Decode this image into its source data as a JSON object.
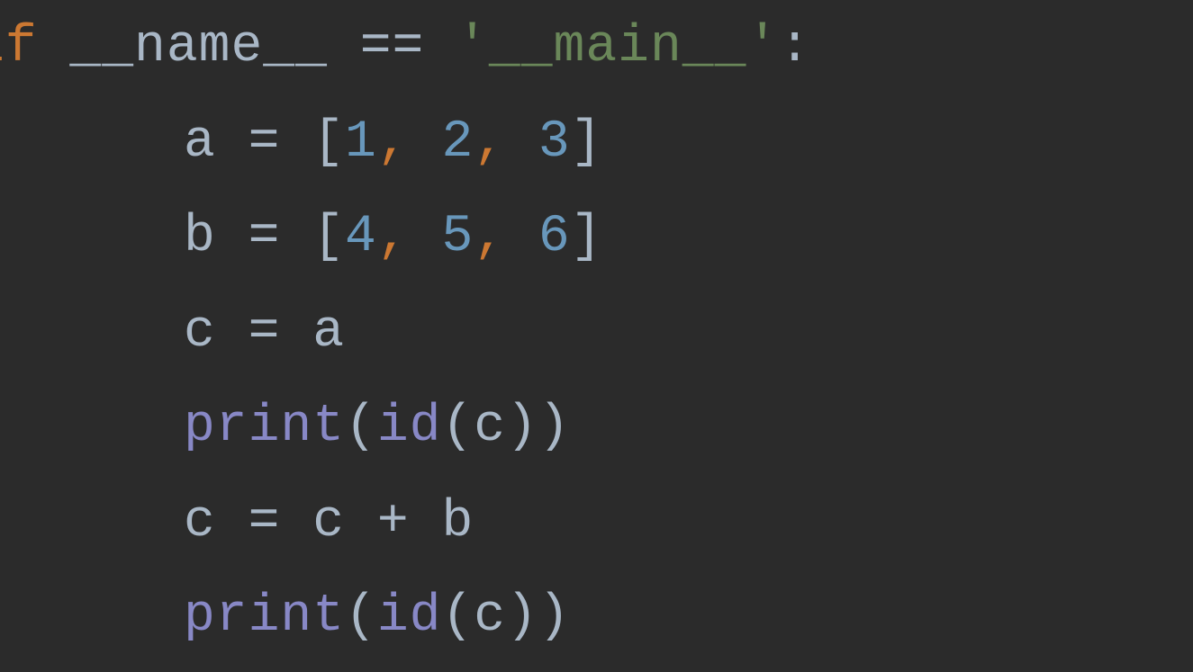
{
  "code": {
    "lines": [
      {
        "indent": 0,
        "tokens": [
          {
            "t": "if",
            "c": "keyword"
          },
          {
            "t": " __name__ ",
            "c": "default"
          },
          {
            "t": "==",
            "c": "default"
          },
          {
            "t": " ",
            "c": "default"
          },
          {
            "t": "'__main__'",
            "c": "string"
          },
          {
            "t": ":",
            "c": "default"
          }
        ]
      },
      {
        "indent": 1,
        "tokens": [
          {
            "t": "a = [",
            "c": "default"
          },
          {
            "t": "1",
            "c": "number"
          },
          {
            "t": ",",
            "c": "comma"
          },
          {
            "t": " ",
            "c": "default"
          },
          {
            "t": "2",
            "c": "number"
          },
          {
            "t": ",",
            "c": "comma"
          },
          {
            "t": " ",
            "c": "default"
          },
          {
            "t": "3",
            "c": "number"
          },
          {
            "t": "]",
            "c": "default"
          }
        ]
      },
      {
        "indent": 1,
        "tokens": [
          {
            "t": "b = [",
            "c": "default"
          },
          {
            "t": "4",
            "c": "number"
          },
          {
            "t": ",",
            "c": "comma"
          },
          {
            "t": " ",
            "c": "default"
          },
          {
            "t": "5",
            "c": "number"
          },
          {
            "t": ",",
            "c": "comma"
          },
          {
            "t": " ",
            "c": "default"
          },
          {
            "t": "6",
            "c": "number"
          },
          {
            "t": "]",
            "c": "default"
          }
        ]
      },
      {
        "indent": 1,
        "tokens": [
          {
            "t": "c = a",
            "c": "default"
          }
        ]
      },
      {
        "indent": 1,
        "tokens": [
          {
            "t": "print",
            "c": "builtin"
          },
          {
            "t": "(",
            "c": "paren"
          },
          {
            "t": "id",
            "c": "builtin"
          },
          {
            "t": "(c))",
            "c": "paren"
          }
        ]
      },
      {
        "indent": 1,
        "tokens": [
          {
            "t": "c = c + b",
            "c": "default"
          }
        ]
      },
      {
        "indent": 1,
        "tokens": [
          {
            "t": "print",
            "c": "builtin"
          },
          {
            "t": "(",
            "c": "paren"
          },
          {
            "t": "id",
            "c": "builtin"
          },
          {
            "t": "(c))",
            "c": "paren"
          }
        ]
      }
    ]
  },
  "colors": {
    "background": "#2b2b2b",
    "default": "#a9b7c6",
    "keyword": "#cc7832",
    "builtin": "#8888c6",
    "string": "#6a8759",
    "number": "#6897bb",
    "comma": "#cc7832"
  }
}
